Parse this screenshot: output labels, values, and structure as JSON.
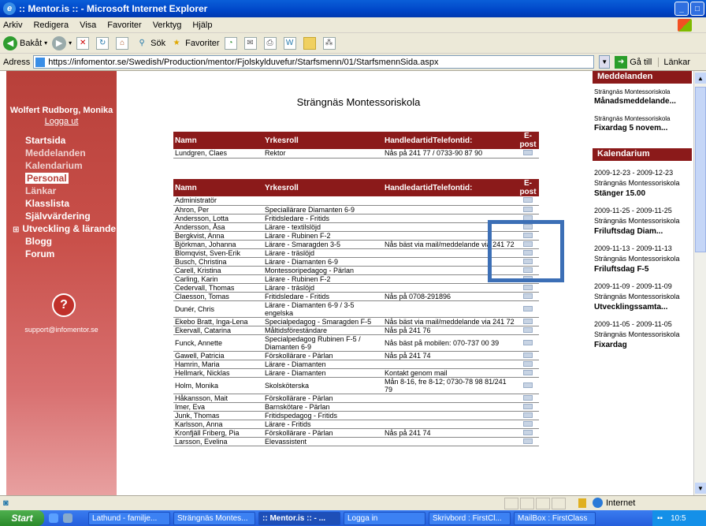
{
  "window": {
    "title": ":: Mentor.is :: - Microsoft Internet Explorer",
    "menu": [
      "Arkiv",
      "Redigera",
      "Visa",
      "Favoriter",
      "Verktyg",
      "Hjälp"
    ],
    "toolbar": {
      "back": "Bakåt",
      "search": "Sök",
      "favorites": "Favoriter"
    },
    "address_label": "Adress",
    "url": "https://infomentor.se/Swedish/Production/mentor/Fjolskylduvefur/Starfsmenn/01/StarfsmennSida.aspx",
    "go": "Gå till",
    "links": "Länkar"
  },
  "sidebar": {
    "user": "Wolfert Rudborg, Monika",
    "logout": "Logga ut",
    "nav": [
      {
        "label": "Startsida"
      },
      {
        "label": "Meddelanden"
      },
      {
        "label": "Kalendarium"
      },
      {
        "label": "Personal"
      },
      {
        "label": "Länkar"
      },
      {
        "label": "Klasslista"
      },
      {
        "label": "Självvärdering"
      },
      {
        "label": "Utveckling & lärande"
      },
      {
        "label": "Blogg"
      },
      {
        "label": "Forum"
      }
    ],
    "help": "?",
    "support": "support@infomentor.se"
  },
  "main": {
    "school": "Strängnäs Montessoriskola",
    "principal_table": {
      "headers": [
        "Namn",
        "Yrkesroll",
        "HandledartidTelefontid:",
        "E-post"
      ],
      "rows": [
        {
          "name": "Lundgren, Claes",
          "role": "Rektor",
          "contact": "Nås på 241 77 / 0733-90 87 90"
        }
      ]
    },
    "staff_table": {
      "headers": [
        "Namn",
        "Yrkesroll",
        "HandledartidTelefontid:",
        "E-post"
      ],
      "rows": [
        {
          "name": "Administratör",
          "role": "",
          "contact": ""
        },
        {
          "name": "Ahron, Per",
          "role": "Speciallärare Diamanten 6-9",
          "contact": ""
        },
        {
          "name": "Andersson, Lotta",
          "role": "Fritidsledare - Fritids",
          "contact": ""
        },
        {
          "name": "Andersson, Åsa",
          "role": "Lärare - textilslöjd",
          "contact": ""
        },
        {
          "name": "Bergkvist, Anna",
          "role": "Lärare - Rubinen F-2",
          "contact": ""
        },
        {
          "name": "Björkman, Johanna",
          "role": "Lärare - Smaragden 3-5",
          "contact": "Nås bäst via mail/meddelande via 241 72"
        },
        {
          "name": "Blomqvist, Sven-Erik",
          "role": "Lärare - träslöjd",
          "contact": ""
        },
        {
          "name": "Busch, Christina",
          "role": "Lärare - Diamanten 6-9",
          "contact": ""
        },
        {
          "name": "Carell, Kristina",
          "role": "Montessoripedagog - Pärlan",
          "contact": ""
        },
        {
          "name": "Carling, Karin",
          "role": "Lärare - Rubinen F-2",
          "contact": ""
        },
        {
          "name": "Cedervall, Thomas",
          "role": "Lärare - träslöjd",
          "contact": ""
        },
        {
          "name": "Claesson, Tomas",
          "role": "Fritidsledare - Fritids",
          "contact": "Nås på 0708-291896"
        },
        {
          "name": "Dunér, Chris",
          "role": "Lärare - Diamanten 6-9 / 3-5 engelska",
          "contact": ""
        },
        {
          "name": "Ekebo Bratt, Inga-Lena",
          "role": "Specialpedagog - Smaragden F-5",
          "contact": "Nås bäst via mail/meddelande via 241 72"
        },
        {
          "name": "Ekervall, Catarina",
          "role": "Måltidsföreständare",
          "contact": "Nås på 241 76"
        },
        {
          "name": "Funck, Annette",
          "role": "Specialpedagog Rubinen F-5 / Diamanten 6-9",
          "contact": "Nås bäst på mobilen: 070-737 00 39"
        },
        {
          "name": "Gawell, Patricia",
          "role": "Förskollärare - Pärlan",
          "contact": "Nås på 241 74"
        },
        {
          "name": "Hamrin, Maria",
          "role": "Lärare - Diamanten",
          "contact": ""
        },
        {
          "name": "Hellmark, Nicklas",
          "role": "Lärare - Diamanten",
          "contact": "Kontakt genom mail"
        },
        {
          "name": "Holm, Monika",
          "role": "Skolsköterska",
          "contact": "Mån 8-16, fre 8-12; 0730-78 98 81/241 79"
        },
        {
          "name": "Håkansson, Mait",
          "role": "Förskollärare - Pärlan",
          "contact": ""
        },
        {
          "name": "Imer, Eva",
          "role": "Barnskötare - Pärlan",
          "contact": ""
        },
        {
          "name": "Junk, Thomas",
          "role": "Fritidspedagog - Fritids",
          "contact": ""
        },
        {
          "name": "Karlsson, Anna",
          "role": "Lärare - Fritids",
          "contact": ""
        },
        {
          "name": "Kronfjäll Friberg, Pia",
          "role": "Förskollärare - Pärlan",
          "contact": "Nås på 241 74"
        },
        {
          "name": "Larsson, Evelina",
          "role": "Elevassistent",
          "contact": ""
        }
      ]
    }
  },
  "right": {
    "messages_header": "Meddelanden",
    "messages": [
      {
        "school": "Strängnäs Montessoriskola",
        "title": "Månadsmeddelande..."
      },
      {
        "school": "Strängnäs Montessoriskola",
        "title": "Fixardag 5 novem..."
      }
    ],
    "calendar_header": "Kalendarium",
    "events": [
      {
        "dates": "2009-12-23 - 2009-12-23",
        "school": "Strängnäs Montessoriskola",
        "title": "Stänger 15.00"
      },
      {
        "dates": "2009-11-25 - 2009-11-25",
        "school": "Strängnäs Montessoriskola",
        "title": "Friluftsdag Diam..."
      },
      {
        "dates": "2009-11-13 - 2009-11-13",
        "school": "Strängnäs Montessoriskola",
        "title": "Friluftsdag F-5"
      },
      {
        "dates": "2009-11-09 - 2009-11-09",
        "school": "Strängnäs Montessoriskola",
        "title": "Utvecklingssamta..."
      },
      {
        "dates": "2009-11-05 - 2009-11-05",
        "school": "Strängnäs Montessoriskola",
        "title": "Fixardag"
      }
    ]
  },
  "status": {
    "zone": "Internet"
  },
  "taskbar": {
    "start": "Start",
    "tasks": [
      "Lathund - familje...",
      "Strängnäs Montes...",
      ":: Mentor.is :: - ...",
      "Logga in",
      "Skrivbord : FirstCl...",
      "MailBox : FirstClass"
    ],
    "clock": "10:5"
  }
}
